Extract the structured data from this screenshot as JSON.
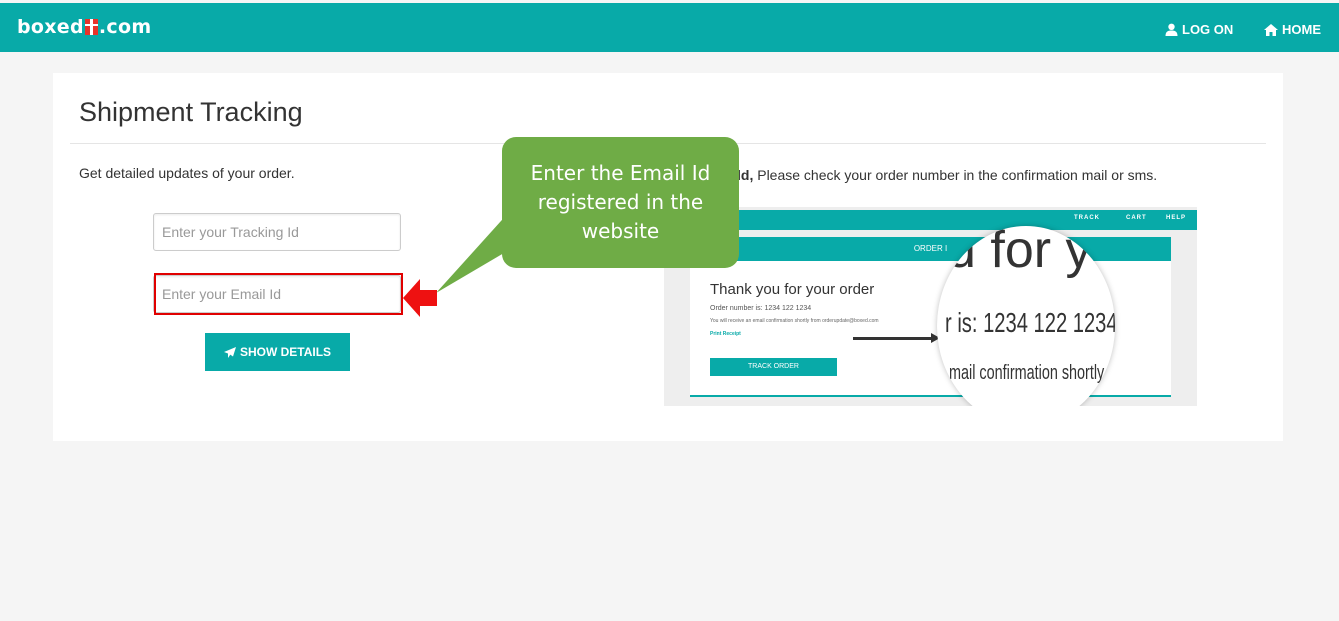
{
  "header": {
    "logo_left": "boxed",
    "logo_right": ".com",
    "logon_label": "LOG ON",
    "home_label": "HOME"
  },
  "page": {
    "title": "Shipment Tracking",
    "subtitle": "Get detailed updates of your order."
  },
  "form": {
    "tracking_placeholder": "Enter your Tracking Id",
    "email_placeholder": "Enter your Email Id",
    "submit_label": "SHOW DETAILS"
  },
  "instruction": {
    "bold": "ld,",
    "text": " Please check your order number in the confirmation mail or sms."
  },
  "sample_image": {
    "nav_track": "TRACK",
    "nav_cart": "CART",
    "nav_help": "HELP",
    "panel_heading": "ORDER I",
    "thanks": "Thank you for your order",
    "order_number": "Order number is: 1234 122 1234",
    "email_note": "You will receive an email confirmation shortly from orderupdate@boxed.com",
    "print_receipt": "Print Receipt",
    "track_order_button": "TRACK ORDER",
    "magnifier_big": "d for yo",
    "magnifier_mid": "r is: 1234 122 1234",
    "magnifier_small": "mail confirmation shortly f"
  },
  "annotation": {
    "callout_text": "Enter the Email Id registered in the website",
    "callout_color": "#6fac46",
    "highlight_color": "#e00000"
  },
  "colors": {
    "brand": "#08aaa8",
    "background": "#f5f5f5"
  },
  "icons": {
    "logon": "user-icon",
    "home": "home-icon",
    "submit": "paper-plane-icon",
    "logo": "gift-icon"
  }
}
